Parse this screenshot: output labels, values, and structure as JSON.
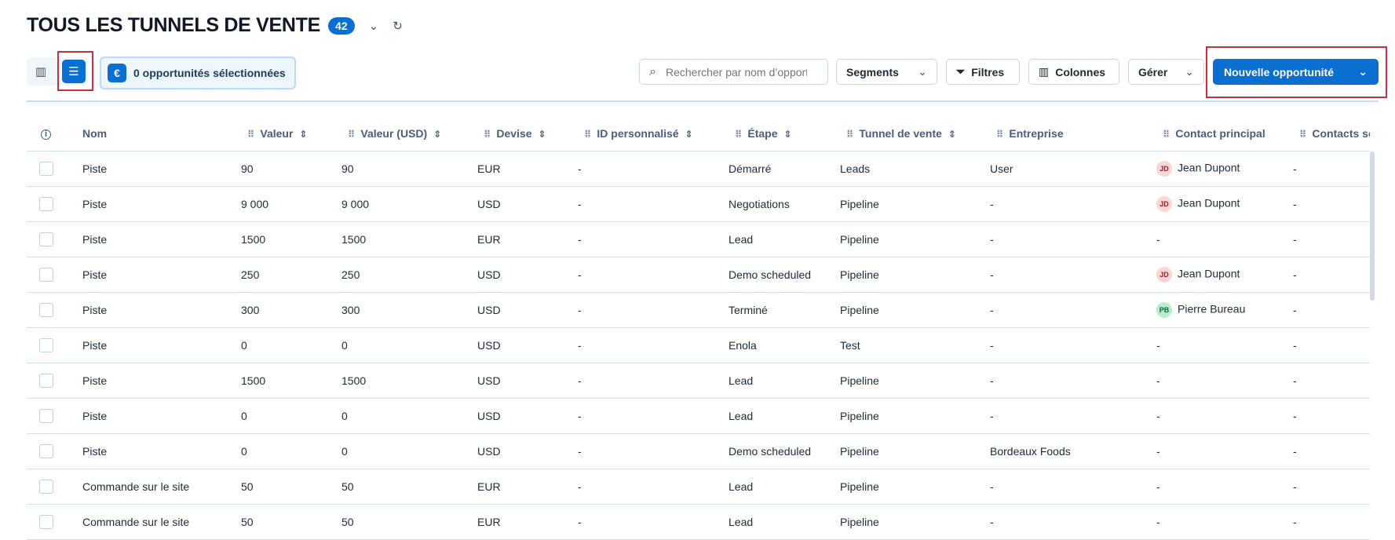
{
  "header": {
    "title": "TOUS LES TUNNELS DE VENTE",
    "count": "42"
  },
  "toolbar": {
    "selected": "0 opportunités sélectionnées",
    "search_placeholder": "Rechercher par nom d’opportunité",
    "segments": "Segments",
    "filters": "Filtres",
    "columns": "Colonnes",
    "manage": "Gérer",
    "new": "Nouvelle opportunité"
  },
  "colors": {
    "accent": "#0a6fd1",
    "highlight": "#c8313c"
  },
  "table": {
    "columns": [
      "Nom",
      "Valeur",
      "Valeur (USD)",
      "Devise",
      "ID personnalisé",
      "Étape",
      "Tunnel de vente",
      "Entreprise",
      "Contact principal",
      "Contacts secondaires"
    ],
    "rows": [
      [
        "Piste",
        "90",
        "90",
        "EUR",
        "-",
        "Démarré",
        "Leads",
        "User",
        {
          "initials": "JD",
          "name": "Jean Dupont",
          "tone": "red"
        },
        "-"
      ],
      [
        "Piste",
        "9 000",
        "9 000",
        "USD",
        "-",
        "Negotiations",
        "Pipeline",
        "-",
        {
          "initials": "JD",
          "name": "Jean Dupont",
          "tone": "red"
        },
        "-"
      ],
      [
        "Piste",
        "1500",
        "1500",
        "EUR",
        "-",
        "Lead",
        "Pipeline",
        "-",
        null,
        "-"
      ],
      [
        "Piste",
        "250",
        "250",
        "USD",
        "-",
        "Demo scheduled",
        "Pipeline",
        "-",
        {
          "initials": "JD",
          "name": "Jean Dupont",
          "tone": "red"
        },
        "-"
      ],
      [
        "Piste",
        "300",
        "300",
        "USD",
        "-",
        "Terminé",
        "Pipeline",
        "-",
        {
          "initials": "PB",
          "name": "Pierre Bureau",
          "tone": "green"
        },
        "-"
      ],
      [
        "Piste",
        "0",
        "0",
        "USD",
        "-",
        "Enola",
        "Test",
        "-",
        null,
        "-"
      ],
      [
        "Piste",
        "1500",
        "1500",
        "USD",
        "-",
        "Lead",
        "Pipeline",
        "-",
        null,
        "-"
      ],
      [
        "Piste",
        "0",
        "0",
        "USD",
        "-",
        "Lead",
        "Pipeline",
        "-",
        null,
        "-"
      ],
      [
        "Piste",
        "0",
        "0",
        "USD",
        "-",
        "Demo scheduled",
        "Pipeline",
        "Bordeaux Foods",
        null,
        "-"
      ],
      [
        "Commande sur le site",
        "50",
        "50",
        "EUR",
        "-",
        "Lead",
        "Pipeline",
        "-",
        null,
        "-"
      ],
      [
        "Commande sur le site",
        "50",
        "50",
        "EUR",
        "-",
        "Lead",
        "Pipeline",
        "-",
        null,
        "-"
      ]
    ]
  }
}
